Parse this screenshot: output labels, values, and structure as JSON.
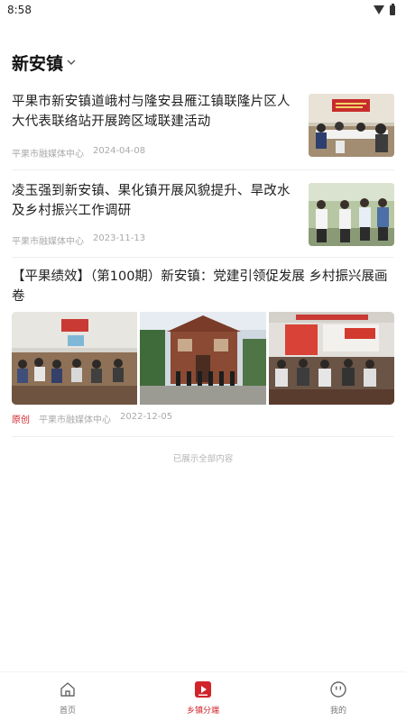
{
  "status_bar": {
    "time": "8:58"
  },
  "header": {
    "title": "新安镇"
  },
  "news": [
    {
      "title": "平果市新安镇道峨村与隆安县雁江镇联隆片区人大代表联络站开展跨区域联建活动",
      "source": "平果市融媒体中心",
      "date": "2024-04-08"
    },
    {
      "title": "凌玉强到新安镇、果化镇开展风貌提升、旱改水及乡村振兴工作调研",
      "source": "平果市融媒体中心",
      "date": "2023-11-13"
    }
  ],
  "gallery_post": {
    "title": "【平果绩效】（第100期）新安镇：党建引领促发展  乡村振兴展画卷",
    "tag": "原创",
    "source": "平果市融媒体中心",
    "date": "2022-12-05"
  },
  "end_note": "已展示全部内容",
  "tabbar": {
    "items": [
      {
        "label": "首页",
        "icon": "home-icon"
      },
      {
        "label": "乡镇分端",
        "icon": "play-square-icon"
      },
      {
        "label": "我的",
        "icon": "smiley-icon"
      }
    ],
    "active_color": "#d1232a"
  }
}
